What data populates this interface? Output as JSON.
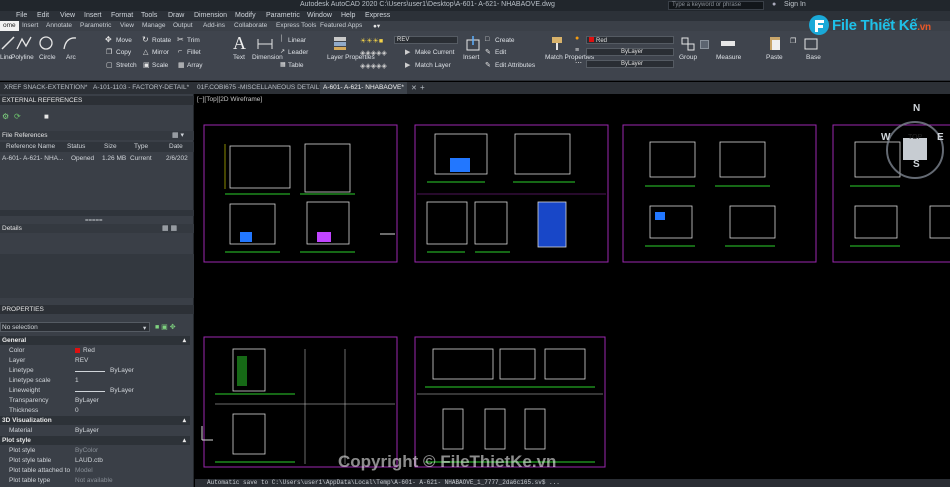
{
  "titlebar": {
    "title": "Autodesk AutoCAD 2020    C:\\Users\\user1\\Desktop\\A-601- A-621- NHABAOVE.dwg",
    "search_placeholder": "Type a keyword or phrase",
    "signin": "Sign In"
  },
  "menubar": [
    "File",
    "Edit",
    "View",
    "Insert",
    "Format",
    "Tools",
    "Draw",
    "Dimension",
    "Modify",
    "Parametric",
    "Window",
    "Help",
    "Express"
  ],
  "ribbon_tabs": {
    "active": "ome",
    "items": [
      "Insert",
      "Annotate",
      "Parametric",
      "View",
      "Manage",
      "Output",
      "Add-ins",
      "Collaborate",
      "Express Tools",
      "Featured Apps"
    ]
  },
  "ribbon": {
    "draw": [
      "Line",
      "Polyline",
      "Circle",
      "Arc"
    ],
    "modify": [
      "Move",
      "Rotate",
      "Trim",
      "Copy",
      "Mirror",
      "Fillet",
      "Stretch",
      "Scale",
      "Array"
    ],
    "annotation": [
      "Text",
      "Dimension",
      "Linear",
      "Leader",
      "Table"
    ],
    "layers": {
      "label": "Layer Properties",
      "current_layer": "REV",
      "make_current": "Make Current",
      "match_layer": "Match Layer"
    },
    "block": [
      "Insert",
      "Create",
      "Edit",
      "Edit Attributes"
    ],
    "properties": {
      "match": "Match Properties",
      "color": "Red",
      "linetype": "ByLayer",
      "lineweight": "ByLayer"
    },
    "group": "Group",
    "measure": "Measure",
    "paste": "Paste",
    "base": "Base"
  },
  "logo": {
    "name": "File Thiết Kế",
    "domain": ".vn"
  },
  "doc_tabs": {
    "items": [
      "XREF SNACK-EXTENTION*",
      "A-101-1103 - FACTORY-DETAIL*",
      "01F.COBI675 -MISCELLANEOUS DETAIL*"
    ],
    "active": "A-601- A-621- NHABAOVE*"
  },
  "xref_panel": {
    "title": "EXTERNAL REFERENCES",
    "file_refs_label": "File References",
    "columns": [
      "Reference Name",
      "Status",
      "Size",
      "Type",
      "Date"
    ],
    "row": {
      "name": "A-601- A-621- NHA...",
      "status": "Opened",
      "size": "1.26 MB",
      "type": "Current",
      "date": "2/6/202"
    },
    "details_label": "Details"
  },
  "properties_panel": {
    "title": "PROPERTIES",
    "selection": "No selection",
    "general_label": "General",
    "general": [
      [
        "Color",
        "Red"
      ],
      [
        "Layer",
        "REV"
      ],
      [
        "Linetype",
        "ByLayer"
      ],
      [
        "Linetype scale",
        "1"
      ],
      [
        "Lineweight",
        "ByLayer"
      ],
      [
        "Transparency",
        "ByLayer"
      ],
      [
        "Thickness",
        "0"
      ]
    ],
    "viz_label": "3D Visualization",
    "viz": [
      [
        "Material",
        "ByLayer"
      ]
    ],
    "plot_label": "Plot style",
    "plot": [
      [
        "Plot style",
        "ByColor"
      ],
      [
        "Plot style table",
        "LAUD.ctb"
      ],
      [
        "Plot table attached to",
        "Model"
      ],
      [
        "Plot table type",
        "Not available"
      ]
    ]
  },
  "viewport": {
    "label": "[−][Top][2D Wireframe]"
  },
  "viewcube": {
    "n": "N",
    "s": "S",
    "w": "W",
    "e": "E",
    "top": "TOP"
  },
  "command_line": "Automatic save to C:\\Users\\user1\\AppData\\Local\\Temp\\A-601- A-621- NHABAOVE_1_7777_2da6c165.sv$ ...",
  "watermark": "Copyright © FileThietKe.vn",
  "colors": {
    "accent": "#1ec0e8",
    "drawing_frame": "#9c27b0",
    "dim_green": "#2bd12b"
  }
}
